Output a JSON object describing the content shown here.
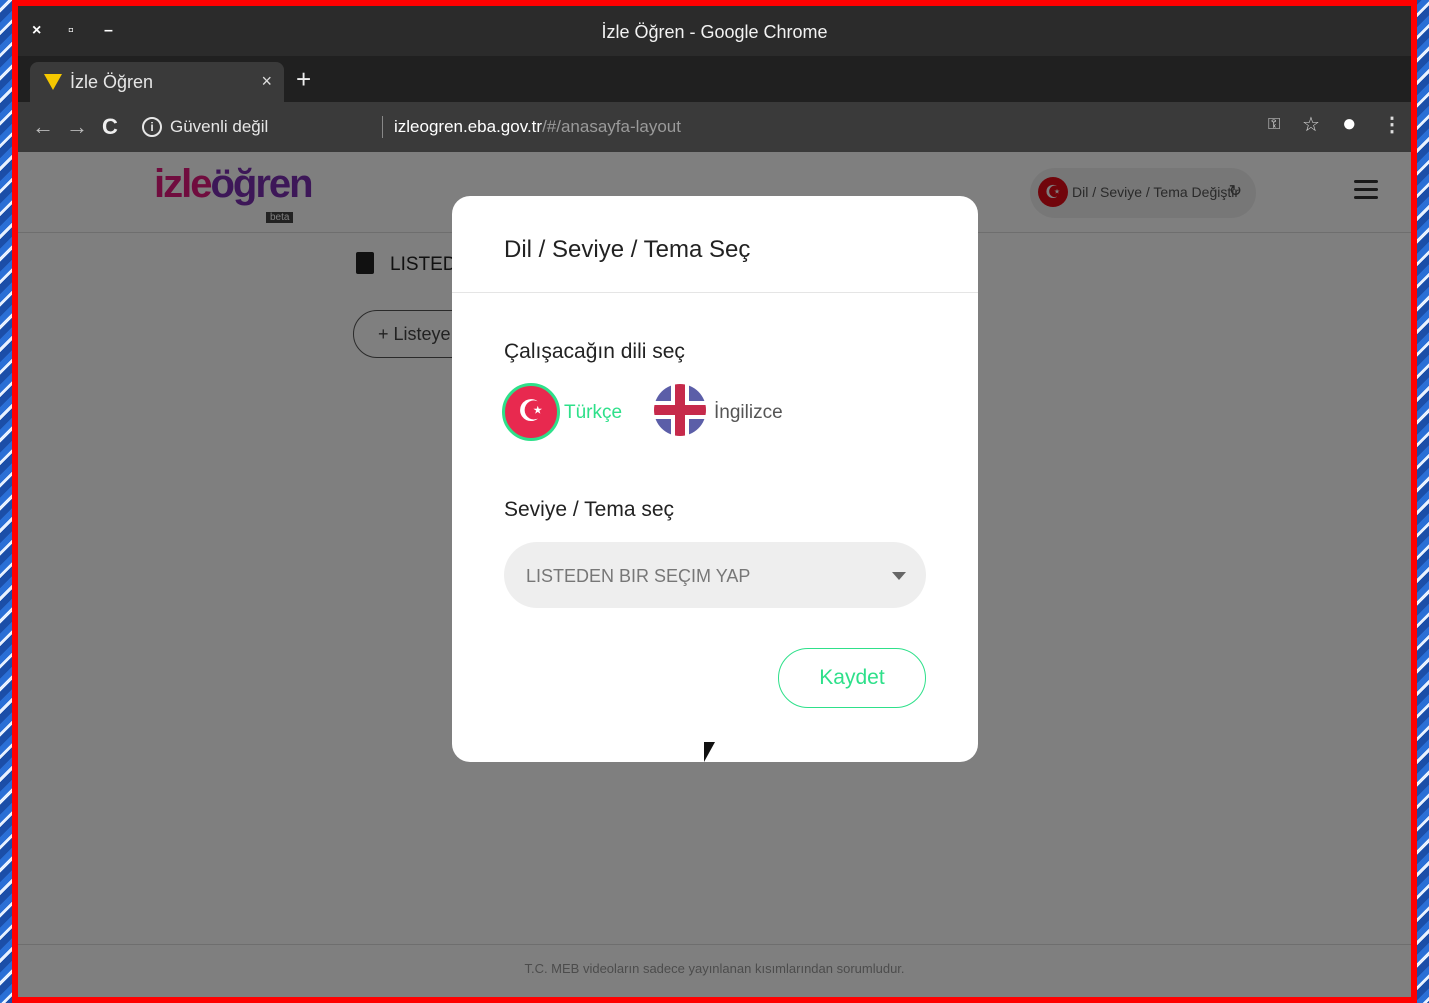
{
  "window": {
    "title": "İzle Öğren - Google Chrome",
    "controls": {
      "close": "×",
      "maximize": "▫",
      "minimize": "–"
    }
  },
  "tab": {
    "title": "İzle Öğren",
    "close": "×",
    "new_tab": "+"
  },
  "address_bar": {
    "security_text": "Güvenli değil",
    "url_host": "izleogren.eba.gov.tr",
    "url_path": "/#/anasayfa-layout"
  },
  "toolbar_icons": {
    "back": "←",
    "forward": "→",
    "reload": "C",
    "key": "⚿",
    "star": "☆",
    "account": "●",
    "menu": "⋮"
  },
  "site": {
    "logo_part1": "izle",
    "logo_part2": "öğren",
    "logo_badge": "beta",
    "lang_switch_label": "Dil / Seviye / Tema Değiştir",
    "list_title": "LISTEDE",
    "add_button": "+ Listeye",
    "footer_text": "T.C. MEB videoların sadece yayınlanan kısımlarından sorumludur."
  },
  "modal": {
    "title": "Dil / Seviye / Tema Seç",
    "language_heading": "Çalışacağın dili seç",
    "languages": [
      {
        "label": "Türkçe",
        "selected": true,
        "icon": "turkey-flag-icon"
      },
      {
        "label": "İngilizce",
        "selected": false,
        "icon": "uk-flag-icon"
      }
    ],
    "level_heading": "Seviye / Tema seç",
    "select_placeholder": "LISTEDEN BIR SEÇIM YAP",
    "save_label": "Kaydet"
  },
  "colors": {
    "accent": "#2ee08a",
    "frame_border": "#ff0000",
    "turkey_red": "#e30a17"
  }
}
